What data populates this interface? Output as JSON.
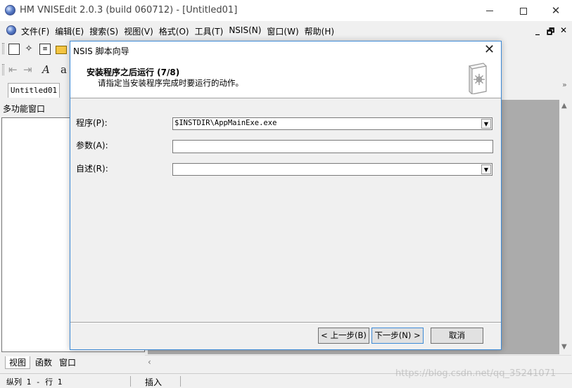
{
  "window": {
    "title": "HM VNISEdit 2.0.3 (build 060712) - [Untitled01]",
    "controls": {
      "minimize": "—",
      "maximize": "☐",
      "close": "✕"
    }
  },
  "menubar": {
    "items": [
      "文件(F)",
      "编辑(E)",
      "搜索(S)",
      "视图(V)",
      "格式(O)",
      "工具(T)",
      "NSIS(N)",
      "窗口(W)",
      "帮助(H)"
    ],
    "mdi_controls": {
      "minimize": "_",
      "restore": "🗗",
      "close": "✕"
    }
  },
  "toolbar": {
    "icons": [
      "new-file-icon",
      "wizard-icon",
      "document-icon",
      "open-folder-icon"
    ],
    "format_icons": [
      "indent-left-icon",
      "indent-right-icon",
      "italic-font-icon",
      "font-size-icon"
    ],
    "italic_glyph": "A",
    "font_glyph": "a"
  },
  "tabs": {
    "document_tab": "Untitled01",
    "scroll_glyph": "»"
  },
  "left_panel": {
    "title": "多功能窗口",
    "bottom_tabs": [
      "视图",
      "函数",
      "窗口"
    ]
  },
  "statusbar": {
    "position": "纵列 1 - 行 1",
    "mode": "插入"
  },
  "watermark": "https://blog.csdn.net/qq_35241071",
  "dialog": {
    "title": "NSIS 脚本向导",
    "close_glyph": "✕",
    "heading": "安装程序之后运行 (7/8)",
    "subheading": "请指定当安装程序完成时要运行的动作。",
    "fields": {
      "program": {
        "label": "程序(P):",
        "value": "$INSTDIR\\AppMainExe.exe"
      },
      "parameters": {
        "label": "参数(A):",
        "value": ""
      },
      "readme": {
        "label": "自述(R):",
        "value": ""
      }
    },
    "buttons": {
      "back": "< 上一步(B)",
      "next": "下一步(N) >",
      "cancel": "取消"
    }
  },
  "colors": {
    "dialog_border": "#3d8ad6",
    "editor_background": "#ababab"
  }
}
